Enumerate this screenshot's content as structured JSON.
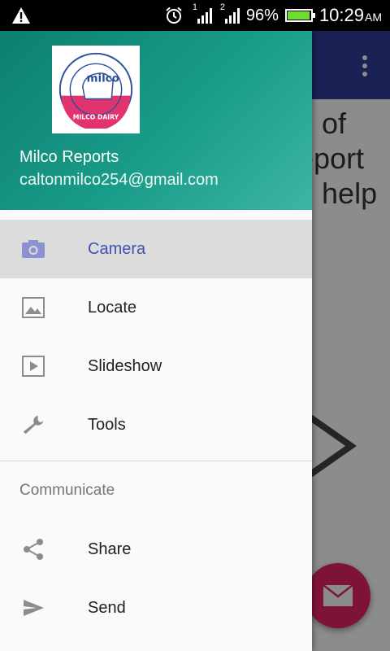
{
  "status_bar": {
    "sim1": "1",
    "sim2": "2",
    "battery_percent": "96%",
    "battery_level": 0.96,
    "time": "10:29",
    "ampm": "AM"
  },
  "background": {
    "text_lines": [
      "d of",
      "eport",
      "d help"
    ]
  },
  "drawer": {
    "header": {
      "logo_text": "milco",
      "logo_ring_text": "MILCO DAIRY",
      "title": "Milco Reports",
      "email": "caltonmilco254@gmail.com"
    },
    "items": [
      {
        "label": "Camera",
        "icon": "camera-icon",
        "active": true
      },
      {
        "label": "Locate",
        "icon": "image-icon"
      },
      {
        "label": "Slideshow",
        "icon": "slideshow-icon"
      },
      {
        "label": "Tools",
        "icon": "wrench-icon"
      }
    ],
    "section_title": "Communicate",
    "section_items": [
      {
        "label": "Share",
        "icon": "share-icon"
      },
      {
        "label": "Send",
        "icon": "send-icon"
      }
    ]
  },
  "colors": {
    "header_start": "#0d7f6e",
    "header_end": "#3db5a3",
    "active_label": "#3f51b5",
    "app_bar": "#2f3d9b",
    "fab": "#e5236a"
  }
}
